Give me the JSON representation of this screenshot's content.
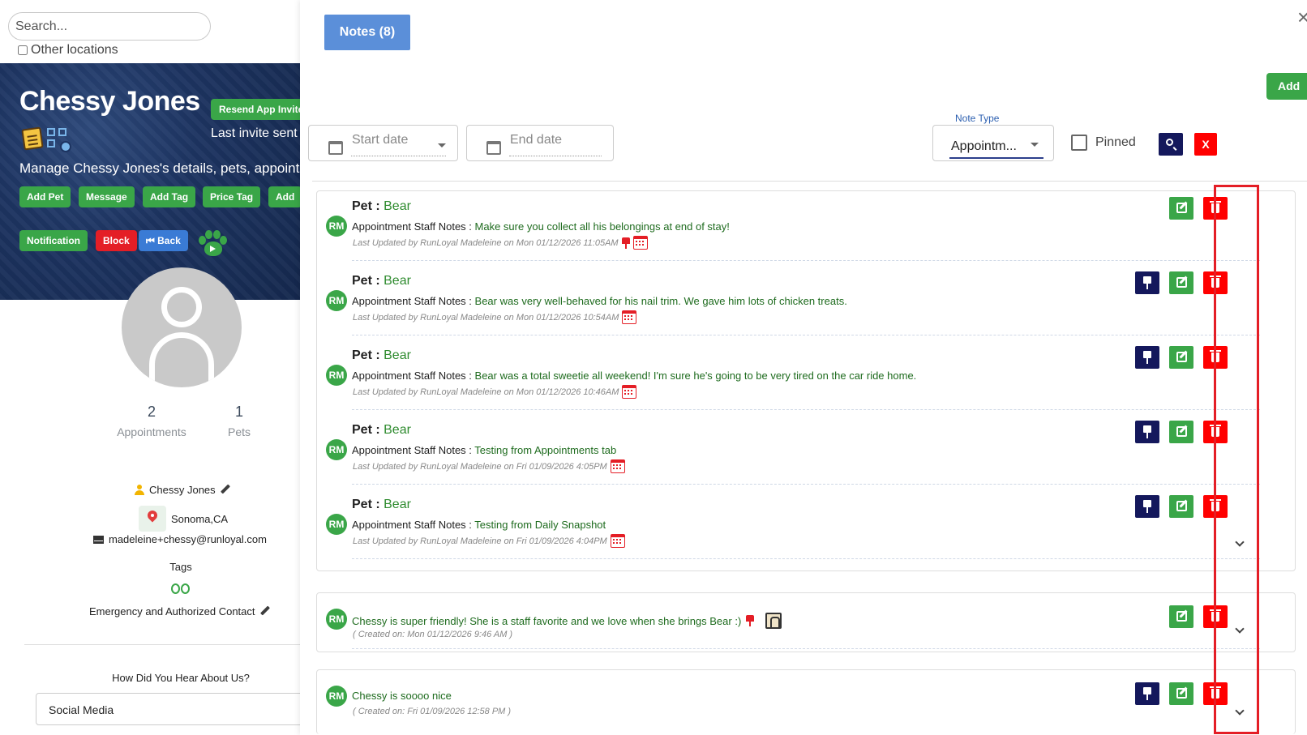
{
  "search": {
    "placeholder": "Search..."
  },
  "other_locations_label": "Other locations",
  "client": {
    "name": "Chessy Jones",
    "resend_label": "Resend App Invite",
    "last_invite": "Last invite sent",
    "description": "Manage Chessy Jones's details, pets, appointments",
    "buttons": {
      "add_pet": "Add Pet",
      "message": "Message",
      "add_tag": "Add Tag",
      "price_tag": "Price Tag",
      "add_more": "Add",
      "notification": "Notification",
      "block": "Block",
      "back": "Back"
    },
    "stats": {
      "appointments_count": "2",
      "appointments_label": "Appointments",
      "pets_count": "1",
      "pets_label": "Pets"
    },
    "owner_name": "Chessy Jones",
    "location": "Sonoma,CA",
    "email": "madeleine+chessy@runloyal.com",
    "tags_label": "Tags",
    "emergency_label": "Emergency and Authorized Contact",
    "hear_label": "How Did You Hear About Us?",
    "hear_value": "Social Media"
  },
  "modal": {
    "tab_label": "Notes (8)",
    "close_symbol": "×",
    "add_label": "Add",
    "filters": {
      "start_placeholder": "Start date",
      "end_placeholder": "End date",
      "note_type_label": "Note Type",
      "note_type_value": "Appointm...",
      "pinned_label": "Pinned",
      "clear_label": "X"
    },
    "appointment_notes": [
      {
        "initials": "RM",
        "pet_label": "Pet :",
        "pet_name": "Bear",
        "type_label": "Appointment Staff Notes :",
        "text": "Make sure you collect all his belongings at end of stay!",
        "meta": "Last Updated by RunLoyal Madeleine on Mon 01/12/2026 11:05AM",
        "pinned": true
      },
      {
        "initials": "RM",
        "pet_label": "Pet :",
        "pet_name": "Bear",
        "type_label": "Appointment Staff Notes :",
        "text": "Bear was very well-behaved for his nail trim. We gave him lots of chicken treats.",
        "meta": "Last Updated by RunLoyal Madeleine on Mon 01/12/2026 10:54AM",
        "pinned": false
      },
      {
        "initials": "RM",
        "pet_label": "Pet :",
        "pet_name": "Bear",
        "type_label": "Appointment Staff Notes :",
        "text": "Bear was a total sweetie all weekend! I'm sure he's going to be very tired on the car ride home.",
        "meta": "Last Updated by RunLoyal Madeleine on Mon 01/12/2026 10:46AM",
        "pinned": false
      },
      {
        "initials": "RM",
        "pet_label": "Pet :",
        "pet_name": "Bear",
        "type_label": "Appointment Staff Notes :",
        "text": "Testing from Appointments tab",
        "meta": "Last Updated by RunLoyal Madeleine on Fri 01/09/2026 4:05PM",
        "pinned": false
      },
      {
        "initials": "RM",
        "pet_label": "Pet :",
        "pet_name": "Bear",
        "type_label": "Appointment Staff Notes :",
        "text": "Testing from Daily Snapshot",
        "meta": "Last Updated by RunLoyal Madeleine on Fri 01/09/2026 4:04PM",
        "pinned": false
      }
    ],
    "general_notes": [
      {
        "initials": "RM",
        "text": "Chessy is super friendly! She is a staff favorite and we love when she brings Bear :)",
        "created": "( Created on: Mon 01/12/2026 9:46 AM )",
        "pinned": true
      },
      {
        "initials": "RM",
        "text": "Chessy is soooo nice",
        "created": "( Created on: Fri 01/09/2026 12:58 PM )",
        "pinned": false
      }
    ]
  }
}
